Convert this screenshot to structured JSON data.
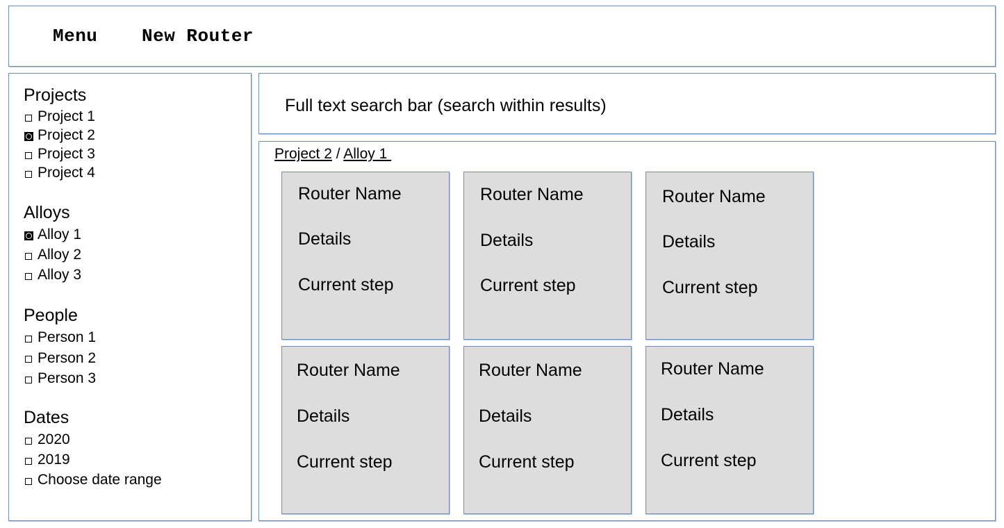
{
  "header": {
    "menu_label": "Menu",
    "new_router_label": "New Router"
  },
  "sidebar": {
    "projects": {
      "title": "Projects",
      "items": [
        {
          "label": "Project 1",
          "checked": false
        },
        {
          "label": "Project 2",
          "checked": true
        },
        {
          "label": "Project 3",
          "checked": false
        },
        {
          "label": "Project 4",
          "checked": false
        }
      ]
    },
    "alloys": {
      "title": "Alloys",
      "items": [
        {
          "label": "Alloy 1",
          "checked": true
        },
        {
          "label": "Alloy 2",
          "checked": false
        },
        {
          "label": "Alloy 3",
          "checked": false
        }
      ]
    },
    "people": {
      "title": "People",
      "items": [
        {
          "label": "Person 1",
          "checked": false
        },
        {
          "label": "Person 2",
          "checked": false
        },
        {
          "label": "Person 3",
          "checked": false
        }
      ]
    },
    "dates": {
      "title": "Dates",
      "items": [
        {
          "label": "2020",
          "checked": false
        },
        {
          "label": "2019",
          "checked": false
        },
        {
          "label": "Choose date range",
          "checked": false
        }
      ]
    }
  },
  "search": {
    "text": "Full text search bar (search within results)"
  },
  "breadcrumb": {
    "project": "Project 2",
    "separator": " / ",
    "alloy": "Alloy 1 "
  },
  "cards": [
    {
      "name": "Router Name",
      "details": "Details",
      "step": "Current step"
    },
    {
      "name": "Router Name",
      "details": "Details",
      "step": "Current step"
    },
    {
      "name": "Router Name",
      "details": "Details",
      "step": "Current step"
    },
    {
      "name": "Router Name",
      "details": "Details",
      "step": "Current step"
    },
    {
      "name": "Router Name",
      "details": "Details",
      "step": "Current step"
    },
    {
      "name": "Router Name",
      "details": "Details",
      "step": "Current step"
    }
  ],
  "colors": {
    "border": "#6d8ebf",
    "card_fill": "#dddddd"
  }
}
